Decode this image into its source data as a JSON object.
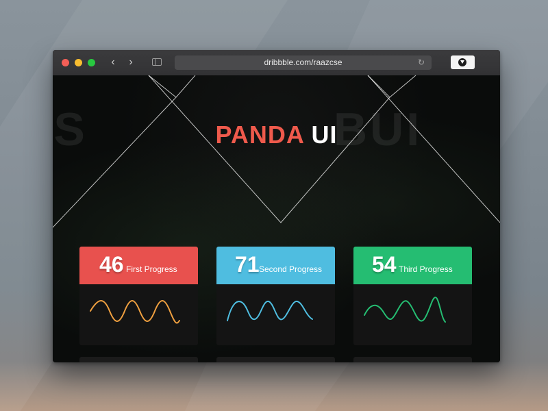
{
  "browser": {
    "url": "dribbble.com/raazcse",
    "nav_back_glyph": "‹",
    "nav_forward_glyph": "›",
    "reload_glyph": "↻",
    "icons": [
      "close-button",
      "minimize-button",
      "maximize-button",
      "back-icon",
      "forward-icon",
      "sidebar-icon",
      "reload-icon",
      "download-icon"
    ]
  },
  "hero": {
    "title_accent": "PANDA",
    "title_main": "UI",
    "background_words_left": "KITS",
    "background_words_right": "BUI"
  },
  "cards": [
    {
      "value": "46",
      "label": "First Progress",
      "color": "#e8514e",
      "wave_color": "#f0a040"
    },
    {
      "value": "71",
      "label": "Second Progress",
      "color": "#4fbde0",
      "wave_color": "#4fbde0"
    },
    {
      "value": "54",
      "label": "Third Progress",
      "color": "#25bd72",
      "wave_color": "#25bd72"
    }
  ],
  "colors": {
    "accent": "#ef5a4c",
    "window_bg": "#0b0d0c",
    "card_bg": "#141414"
  }
}
